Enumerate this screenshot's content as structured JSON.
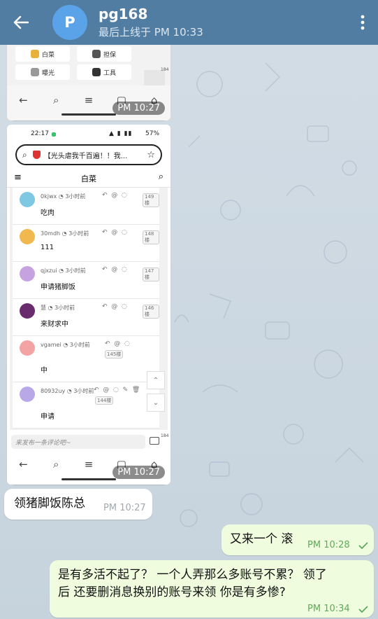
{
  "header": {
    "back_icon": "arrow-left-icon",
    "avatar_letter": "P",
    "avatar_color": "#5aa3e8",
    "name": "pg168",
    "status": "最后上线于 PM 10:33",
    "menu_icon": "more-vertical-icon",
    "bg_color": "#517da2"
  },
  "messages": {
    "img1_time": "PM 10:27",
    "img1": {
      "grid": [
        {
          "label": "白菜",
          "icon": "cabbage-icon"
        },
        {
          "label": "担保",
          "icon": "guarantee-icon"
        },
        {
          "label": "曝光",
          "icon": "exposure-icon"
        },
        {
          "label": "工具",
          "icon": "tools-icon"
        }
      ],
      "side_count": "184"
    },
    "img2_time": "PM 10:27",
    "img2": {
      "status_time": "22:17",
      "battery": "57%",
      "search_text": "【光头虐我千百遍！！我...",
      "topic": "白菜",
      "comments": [
        {
          "user": "0kjwx",
          "meta": "3小时前",
          "text": "吃肉",
          "floor": "149楼"
        },
        {
          "user": "30mdh",
          "meta": "3小时前",
          "text": "111",
          "floor": "148楼"
        },
        {
          "user": "qjxzui",
          "meta": "3小时前",
          "text": "申请猪脚饭",
          "floor": "147楼"
        },
        {
          "user": "慧",
          "meta": "3小时前",
          "text": "来财求中",
          "floor": "146楼"
        },
        {
          "user": "vgamei",
          "meta": "3小时前",
          "text": "中",
          "floor": "145楼"
        },
        {
          "user": "80932uy",
          "meta": "3小时前",
          "text": "申请",
          "floor": "144楼"
        }
      ],
      "input_placeholder": "来发布一条评论吧~",
      "side_count": "184"
    },
    "text_in": "领猪脚饭陈总",
    "text_in_time": "PM 10:27",
    "out1": "又来一个 滚",
    "out1_time": "PM 10:28",
    "out2_line1": "是有多活不起了？ 一个人弄那么多账号不累？ 领了",
    "out2_line2": "后 还要删消息换别的账号来领 你是有多惨?",
    "out2_time": "PM 10:34"
  }
}
